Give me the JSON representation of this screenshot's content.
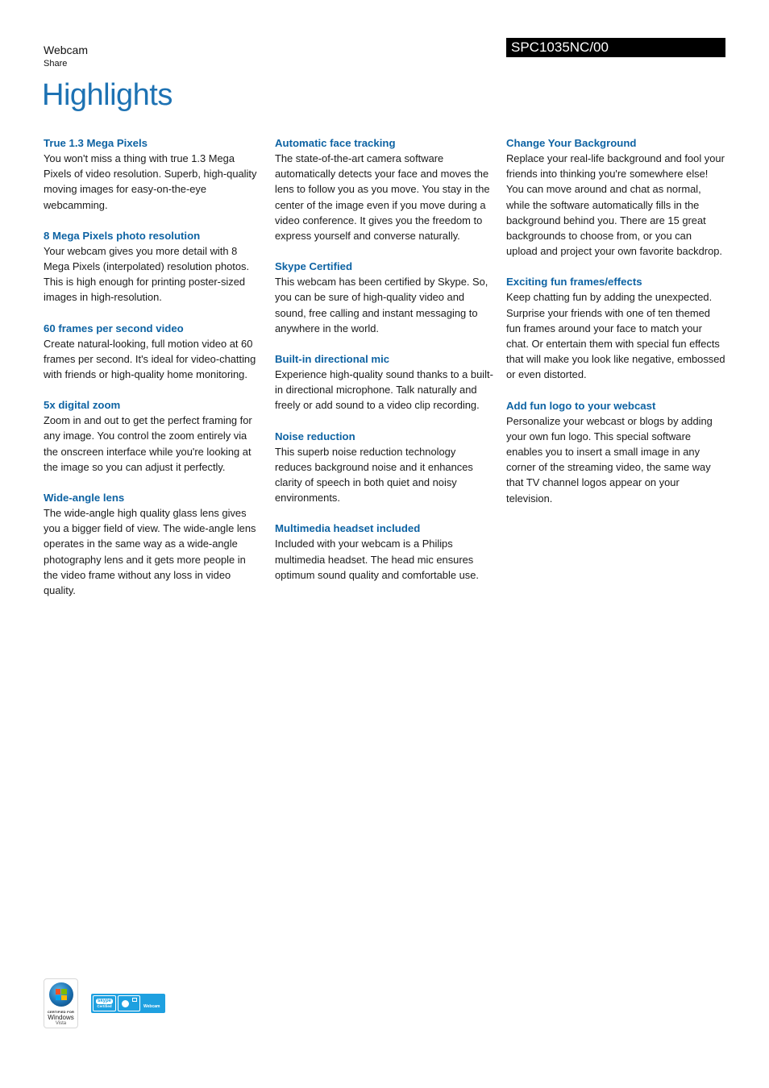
{
  "header": {
    "category": "Webcam",
    "subcategory": "Share",
    "model": "SPC1035NC/00",
    "title": "Highlights"
  },
  "columns": [
    [
      {
        "heading": "True 1.3 Mega Pixels",
        "body": "You won't miss a thing with true 1.3 Mega Pixels of video resolution. Superb, high-quality moving images for easy-on-the-eye webcamming."
      },
      {
        "heading": "8 Mega Pixels photo resolution",
        "body": "Your webcam gives you more detail with 8 Mega Pixels (interpolated) resolution photos. This is high enough for printing poster-sized images in high-resolution."
      },
      {
        "heading": "60 frames per second video",
        "body": "Create natural-looking, full motion video at 60 frames per second. It's ideal for video-chatting with friends or high-quality home monitoring."
      },
      {
        "heading": "5x digital zoom",
        "body": "Zoom in and out to get the perfect framing for any image. You control the zoom entirely via the onscreen interface while you're looking at the image so you can adjust it perfectly."
      },
      {
        "heading": "Wide-angle lens",
        "body": "The wide-angle high quality glass lens gives you a bigger field of view. The wide-angle lens operates in the same way as a wide-angle photography lens and it gets more people in the video frame without any loss in video quality."
      }
    ],
    [
      {
        "heading": "Automatic face tracking",
        "body": "The state-of-the-art camera software automatically detects your face and moves the lens to follow you as you move. You stay in the center of the image even if you move during a video conference. It gives you the freedom to express yourself and converse naturally."
      },
      {
        "heading": "Skype Certified",
        "body": "This webcam has been certified by Skype. So, you can be sure of high-quality video and sound, free calling and instant messaging to anywhere in the world."
      },
      {
        "heading": "Built-in directional mic",
        "body": "Experience high-quality sound thanks to a built-in directional microphone. Talk naturally and freely or add sound to a video clip recording."
      },
      {
        "heading": "Noise reduction",
        "body": "This superb noise reduction technology reduces background noise and it enhances clarity of speech in both quiet and noisy environments."
      },
      {
        "heading": "Multimedia headset included",
        "body": "Included with your webcam is a Philips multimedia headset. The head mic ensures optimum sound quality and comfortable use."
      }
    ],
    [
      {
        "heading": "Change Your Background",
        "body": "Replace your real-life background and fool your friends into thinking you're somewhere else! You can move around and chat as normal, while the software automatically fills in the background behind you. There are 15 great backgrounds to choose from, or you can upload and project your own favorite backdrop."
      },
      {
        "heading": "Exciting fun frames/effects",
        "body": "Keep chatting fun by adding the unexpected. Surprise your friends with one of ten themed fun frames around your face to match your chat. Or entertain them with special fun effects that will make you look like negative, embossed or even distorted."
      },
      {
        "heading": "Add fun logo to your webcast",
        "body": "Personalize your webcast or blogs by adding your own fun logo. This special software enables you to insert a small image in any corner of the streaming video, the same way that TV channel logos appear on your television."
      }
    ]
  ],
  "logos": {
    "vista": {
      "line1": "CERTIFIED FOR",
      "line2": "Windows",
      "line3": "Vista"
    },
    "skype": {
      "brand": "skype",
      "certified": "Certified",
      "product": "Webcam"
    }
  },
  "colors": {
    "title": "#1d72b3",
    "heading": "#0e63a3",
    "model_bar": "#000000",
    "skype_badge": "#1ea0e0"
  }
}
